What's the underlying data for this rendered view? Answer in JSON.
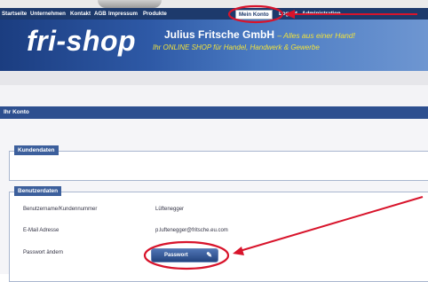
{
  "nav": {
    "items": [
      "Startseite",
      "Unternehmen",
      "Kontakt",
      "AGB",
      "Impressum",
      "Produkte"
    ],
    "active": "Mein Konto",
    "after": [
      "Logout",
      "Administration"
    ]
  },
  "header": {
    "brand": "fri-shop",
    "company": "Julius Fritsche GmbH",
    "tagline": "– Alles aus einer Hand!",
    "slogan": "Ihr ONLINE SHOP für Handel, Handwerk & Gewerbe"
  },
  "page": {
    "title": "Ihr Konto"
  },
  "sections": {
    "customer": {
      "legend": "Kundendaten"
    },
    "user": {
      "legend": "Benutzerdaten",
      "rows": [
        {
          "label": "Benutzername/Kundennummer",
          "value": "Lüftenegger"
        },
        {
          "label": "E-Mail Adresse",
          "value": "p.luftenegger@fritsche.eu.com"
        },
        {
          "label": "Passwort ändern",
          "value": ""
        }
      ],
      "password_button": "Passwort",
      "password_icon": "pencil-icon"
    }
  },
  "colors": {
    "annotation": "#d8142b",
    "nav": "#1d3a6c",
    "accent": "#f2e23b"
  }
}
